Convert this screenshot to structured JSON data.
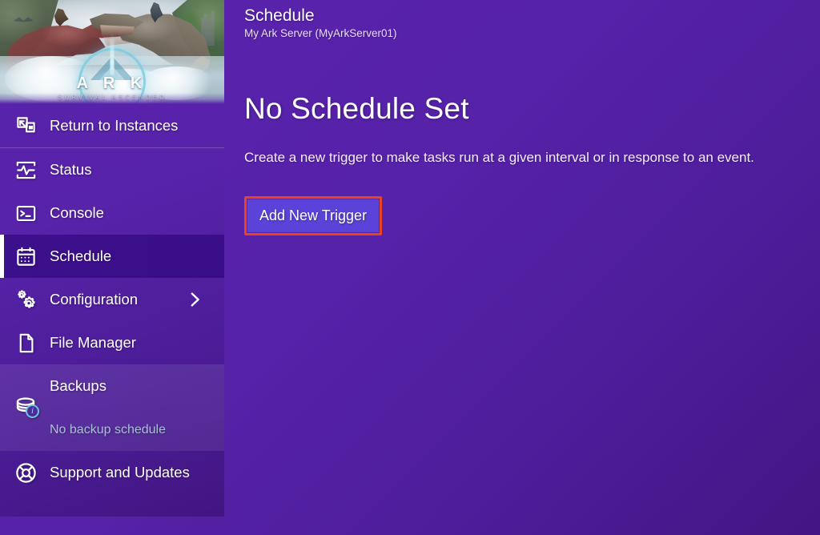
{
  "sidebar": {
    "hero": {
      "logo_word": "A R K",
      "logo_sub": "SURVIVAL ASCENDED"
    },
    "return_item": {
      "label": "Return to Instances",
      "icon": "exit-fullscreen-icon"
    },
    "items": [
      {
        "label": "Status",
        "icon": "activity-monitor-icon",
        "active": false
      },
      {
        "label": "Console",
        "icon": "terminal-icon",
        "active": false
      },
      {
        "label": "Schedule",
        "icon": "calendar-icon",
        "active": true
      },
      {
        "label": "Configuration",
        "icon": "gears-icon",
        "active": false,
        "chevron": "chevron-right-icon"
      },
      {
        "label": "File Manager",
        "icon": "file-icon",
        "active": false
      }
    ],
    "backups": {
      "label": "Backups",
      "status": "No backup schedule",
      "icon": "database-icon",
      "badge": "i"
    },
    "support": {
      "label": "Support and Updates",
      "icon": "lifebuoy-icon"
    }
  },
  "header": {
    "title": "Schedule",
    "subtitle": "My Ark Server (MyArkServer01)"
  },
  "main": {
    "headline": "No Schedule Set",
    "description": "Create a new trigger to make tasks run at a given interval or in response to an event.",
    "add_trigger_label": "Add New Trigger"
  },
  "colors": {
    "background": "#5622a8",
    "active_item": "#3c0f8c",
    "button": "#5b42d8",
    "highlight_border": "#e8441f",
    "muted_text": "#a9bdd6"
  }
}
